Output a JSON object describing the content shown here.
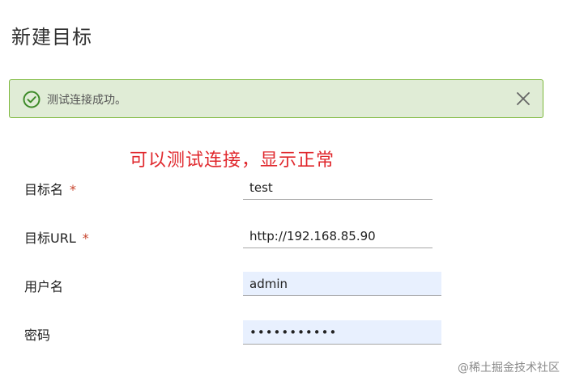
{
  "dialog": {
    "title": "新建目标"
  },
  "alert": {
    "message": "测试连接成功。",
    "status": "success",
    "accent_color": "#7cb83b",
    "background_color": "#e0ecd6"
  },
  "annotation": {
    "text": "可以测试连接，显示正常",
    "color": "#e0282d"
  },
  "form": {
    "target_name": {
      "label": "目标名",
      "required_mark": "*",
      "value": "test"
    },
    "target_url": {
      "label": "目标URL",
      "required_mark": "*",
      "value": "http://192.168.85.90"
    },
    "username": {
      "label": "用户名",
      "value": "admin"
    },
    "password": {
      "label": "密码",
      "value": "•••••••••••"
    }
  },
  "watermark": {
    "text": "@稀土掘金技术社区"
  }
}
